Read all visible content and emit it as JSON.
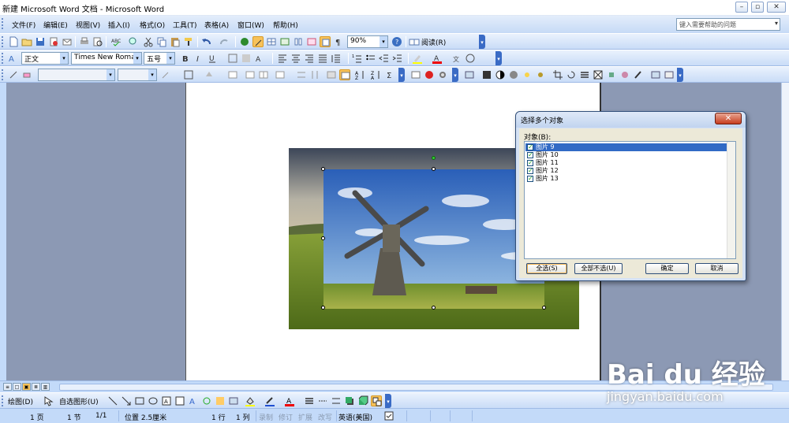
{
  "window": {
    "title": "新建 Microsoft Word 文档 - Microsoft Word"
  },
  "menu": [
    "文件(F)",
    "编辑(E)",
    "视图(V)",
    "插入(I)",
    "格式(O)",
    "工具(T)",
    "表格(A)",
    "窗口(W)",
    "帮助(H)"
  ],
  "help_box": {
    "placeholder": "键入需要帮助的问题"
  },
  "standard_toolbar": {
    "zoom": "90%",
    "read_label": "阅读(R)"
  },
  "format_toolbar": {
    "style": "正文",
    "font": "Times New Roman",
    "size": "五号"
  },
  "draw_toolbar": {
    "draw_label": "绘图(D)",
    "autoshapes_label": "自选图形(U)"
  },
  "status_bar": {
    "page": "1 页",
    "section": "1 节",
    "page_count": "1/1",
    "position": "位置 2.5厘米",
    "line": "1 行",
    "column": "1 列",
    "modes": [
      "录制",
      "修订",
      "扩展",
      "改写"
    ],
    "language": "英语(美国)"
  },
  "dialog": {
    "title": "选择多个对象",
    "list_label": "对象(B):",
    "objects": [
      {
        "label": "图片 9",
        "checked": true,
        "selected": true
      },
      {
        "label": "图片 10",
        "checked": true,
        "selected": false
      },
      {
        "label": "图片 11",
        "checked": true,
        "selected": false
      },
      {
        "label": "图片 12",
        "checked": true,
        "selected": false
      },
      {
        "label": "图片 13",
        "checked": true,
        "selected": false
      }
    ],
    "buttons": {
      "select_all": "全选(S)",
      "select_none": "全部不选(U)",
      "ok": "确定",
      "cancel": "取消"
    }
  },
  "watermark": {
    "brand": "Bai du 经验",
    "url": "jingyan.baidu.com"
  },
  "colors": {
    "accent": "#316ac5",
    "office_blue": "#c3daf9",
    "doc_background": "#8c99b4",
    "close_red": "#c73d1e"
  }
}
